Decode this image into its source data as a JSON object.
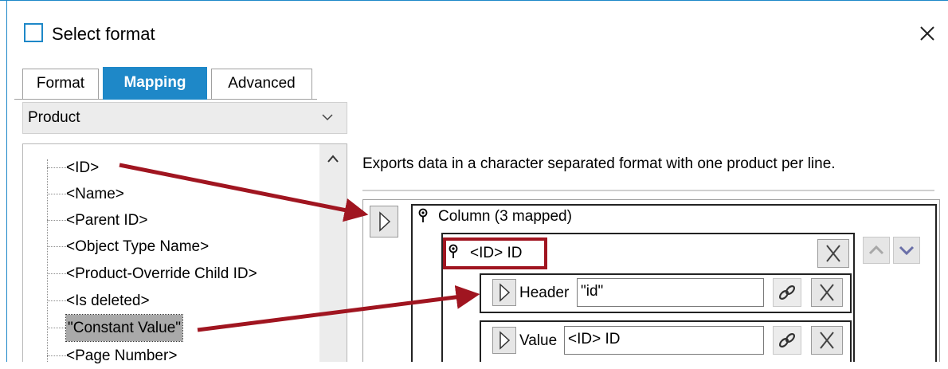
{
  "window": {
    "title": "Select format",
    "close_label": "✕"
  },
  "tabs": [
    {
      "label": "Format",
      "active": false
    },
    {
      "label": "Mapping",
      "active": true
    },
    {
      "label": "Advanced",
      "active": false
    }
  ],
  "object_selector": {
    "selected": "Product"
  },
  "tree": {
    "items": [
      "<ID>",
      "<Name>",
      "<Parent ID>",
      "<Object Type Name>",
      "<Product-Override Child ID>",
      "<Is deleted>",
      "\"Constant Value\"",
      "<Page Number>"
    ],
    "selected_index": 6
  },
  "mapping": {
    "description": "Exports data in a character separated format with one product per line.",
    "column_label": "Column (3 mapped)",
    "id_label": "<ID> ID",
    "header_label": "Header",
    "header_value": "\"id\"",
    "value_label": "Value",
    "value_value": "<ID> ID"
  },
  "colors": {
    "accent": "#1e88c8",
    "annotation_arrow": "#a01520",
    "selected_tree_bg": "#a9a9a9"
  },
  "icons": [
    "checkbox-icon",
    "close-icon",
    "chevron-down-icon",
    "scroll-up-icon",
    "play-triangle-icon",
    "pin-icon",
    "x-icon",
    "arrow-up-icon",
    "arrow-down-icon",
    "link-icon",
    "annotation-arrow"
  ]
}
